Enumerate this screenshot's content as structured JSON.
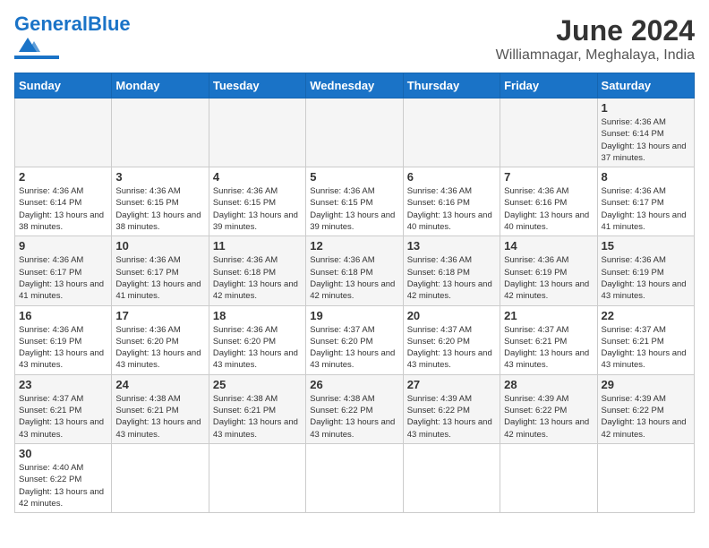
{
  "header": {
    "logo_general": "General",
    "logo_blue": "Blue",
    "title": "June 2024",
    "subtitle": "Williamnagar, Meghalaya, India"
  },
  "days_of_week": [
    "Sunday",
    "Monday",
    "Tuesday",
    "Wednesday",
    "Thursday",
    "Friday",
    "Saturday"
  ],
  "weeks": [
    [
      {
        "day": "",
        "info": ""
      },
      {
        "day": "",
        "info": ""
      },
      {
        "day": "",
        "info": ""
      },
      {
        "day": "",
        "info": ""
      },
      {
        "day": "",
        "info": ""
      },
      {
        "day": "",
        "info": ""
      },
      {
        "day": "1",
        "info": "Sunrise: 4:36 AM\nSunset: 6:14 PM\nDaylight: 13 hours and 37 minutes."
      }
    ],
    [
      {
        "day": "2",
        "info": "Sunrise: 4:36 AM\nSunset: 6:14 PM\nDaylight: 13 hours and 38 minutes."
      },
      {
        "day": "3",
        "info": "Sunrise: 4:36 AM\nSunset: 6:15 PM\nDaylight: 13 hours and 38 minutes."
      },
      {
        "day": "4",
        "info": "Sunrise: 4:36 AM\nSunset: 6:15 PM\nDaylight: 13 hours and 39 minutes."
      },
      {
        "day": "5",
        "info": "Sunrise: 4:36 AM\nSunset: 6:15 PM\nDaylight: 13 hours and 39 minutes."
      },
      {
        "day": "6",
        "info": "Sunrise: 4:36 AM\nSunset: 6:16 PM\nDaylight: 13 hours and 40 minutes."
      },
      {
        "day": "7",
        "info": "Sunrise: 4:36 AM\nSunset: 6:16 PM\nDaylight: 13 hours and 40 minutes."
      },
      {
        "day": "8",
        "info": "Sunrise: 4:36 AM\nSunset: 6:17 PM\nDaylight: 13 hours and 41 minutes."
      }
    ],
    [
      {
        "day": "9",
        "info": "Sunrise: 4:36 AM\nSunset: 6:17 PM\nDaylight: 13 hours and 41 minutes."
      },
      {
        "day": "10",
        "info": "Sunrise: 4:36 AM\nSunset: 6:17 PM\nDaylight: 13 hours and 41 minutes."
      },
      {
        "day": "11",
        "info": "Sunrise: 4:36 AM\nSunset: 6:18 PM\nDaylight: 13 hours and 42 minutes."
      },
      {
        "day": "12",
        "info": "Sunrise: 4:36 AM\nSunset: 6:18 PM\nDaylight: 13 hours and 42 minutes."
      },
      {
        "day": "13",
        "info": "Sunrise: 4:36 AM\nSunset: 6:18 PM\nDaylight: 13 hours and 42 minutes."
      },
      {
        "day": "14",
        "info": "Sunrise: 4:36 AM\nSunset: 6:19 PM\nDaylight: 13 hours and 42 minutes."
      },
      {
        "day": "15",
        "info": "Sunrise: 4:36 AM\nSunset: 6:19 PM\nDaylight: 13 hours and 43 minutes."
      }
    ],
    [
      {
        "day": "16",
        "info": "Sunrise: 4:36 AM\nSunset: 6:19 PM\nDaylight: 13 hours and 43 minutes."
      },
      {
        "day": "17",
        "info": "Sunrise: 4:36 AM\nSunset: 6:20 PM\nDaylight: 13 hours and 43 minutes."
      },
      {
        "day": "18",
        "info": "Sunrise: 4:36 AM\nSunset: 6:20 PM\nDaylight: 13 hours and 43 minutes."
      },
      {
        "day": "19",
        "info": "Sunrise: 4:37 AM\nSunset: 6:20 PM\nDaylight: 13 hours and 43 minutes."
      },
      {
        "day": "20",
        "info": "Sunrise: 4:37 AM\nSunset: 6:20 PM\nDaylight: 13 hours and 43 minutes."
      },
      {
        "day": "21",
        "info": "Sunrise: 4:37 AM\nSunset: 6:21 PM\nDaylight: 13 hours and 43 minutes."
      },
      {
        "day": "22",
        "info": "Sunrise: 4:37 AM\nSunset: 6:21 PM\nDaylight: 13 hours and 43 minutes."
      }
    ],
    [
      {
        "day": "23",
        "info": "Sunrise: 4:37 AM\nSunset: 6:21 PM\nDaylight: 13 hours and 43 minutes."
      },
      {
        "day": "24",
        "info": "Sunrise: 4:38 AM\nSunset: 6:21 PM\nDaylight: 13 hours and 43 minutes."
      },
      {
        "day": "25",
        "info": "Sunrise: 4:38 AM\nSunset: 6:21 PM\nDaylight: 13 hours and 43 minutes."
      },
      {
        "day": "26",
        "info": "Sunrise: 4:38 AM\nSunset: 6:22 PM\nDaylight: 13 hours and 43 minutes."
      },
      {
        "day": "27",
        "info": "Sunrise: 4:39 AM\nSunset: 6:22 PM\nDaylight: 13 hours and 43 minutes."
      },
      {
        "day": "28",
        "info": "Sunrise: 4:39 AM\nSunset: 6:22 PM\nDaylight: 13 hours and 42 minutes."
      },
      {
        "day": "29",
        "info": "Sunrise: 4:39 AM\nSunset: 6:22 PM\nDaylight: 13 hours and 42 minutes."
      }
    ],
    [
      {
        "day": "30",
        "info": "Sunrise: 4:40 AM\nSunset: 6:22 PM\nDaylight: 13 hours and 42 minutes."
      },
      {
        "day": "",
        "info": ""
      },
      {
        "day": "",
        "info": ""
      },
      {
        "day": "",
        "info": ""
      },
      {
        "day": "",
        "info": ""
      },
      {
        "day": "",
        "info": ""
      },
      {
        "day": "",
        "info": ""
      }
    ]
  ]
}
